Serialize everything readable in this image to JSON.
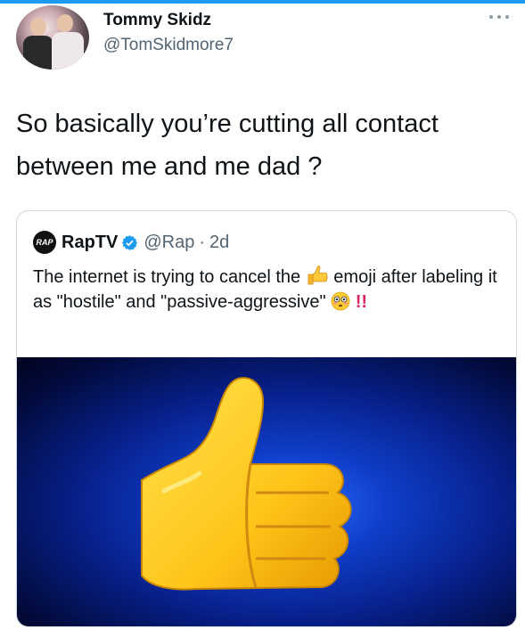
{
  "tweet": {
    "user_name": "Tommy Skidz",
    "user_handle": "@TomSkidmore7",
    "text": "So basically you’re cutting all contact between me and me dad ?"
  },
  "quote": {
    "logo_text": "RAP",
    "name": "RapTV",
    "handle": "@Rap",
    "separator": "·",
    "time": "2d",
    "text_part1": "The internet is trying to cancel the",
    "text_part2": "emoji after labeling it as \"hostile\" and \"passive-aggressive\"",
    "exclaim": "!!",
    "image_icon": "thumbs-up-emoji",
    "inline_icons": [
      "thumbs-up-emoji",
      "flushed-face-emoji"
    ]
  },
  "colors": {
    "accent": "#1d9bf0",
    "verified": "#1d9bf0",
    "exclaim": "#e0245e",
    "image_bg": "#0f3ec9"
  }
}
